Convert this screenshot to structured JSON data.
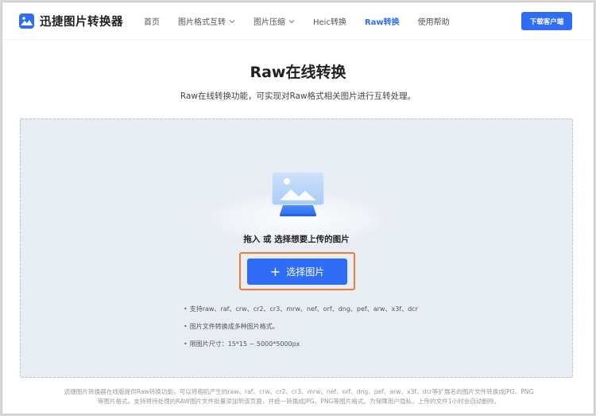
{
  "brand": {
    "name": "迅捷图片转换器"
  },
  "nav": {
    "items": [
      {
        "label": "首页",
        "has_dropdown": false,
        "active": false
      },
      {
        "label": "图片格式互转",
        "has_dropdown": true,
        "active": false
      },
      {
        "label": "图片压缩",
        "has_dropdown": true,
        "active": false
      },
      {
        "label": "Heic转换",
        "has_dropdown": false,
        "active": false
      },
      {
        "label": "Raw转换",
        "has_dropdown": false,
        "active": true
      },
      {
        "label": "使用帮助",
        "has_dropdown": false,
        "active": false
      }
    ]
  },
  "header": {
    "download_label": "下载客户端"
  },
  "main": {
    "title": "Raw在线转换",
    "subtitle": "Raw在线转换功能，可实现对Raw格式相关图片进行互转处理。"
  },
  "upload": {
    "drop_text": "拖入 或 选择想要上传的图片",
    "select_label": "选择图片",
    "bullets": [
      "支持raw、raf、crw、cr2、cr3、mrw、nef、orf、dng、pef、arw、x3f、dcr",
      "图片文件转换成多种图片格式。",
      "限图片尺寸：15*15 ~ 5000*5000px"
    ]
  },
  "footer": {
    "line1": "迅捷图片转换器在线版提供Raw转换功能，可以将相机产生的raw、raf、crw、cr2、cr3、mrw、nef、orf、dng、pef、arw、x3f、dcr等扩展名的图片文件转换成JPG、PNG",
    "line2": "等图片格式。支持将待处理的RAW图片文件批量添加到该页面，并统一转换成JPG、PNG等图片格式。为保障用户隐私，上传的文件1小时会自动删除。"
  },
  "colors": {
    "accent": "#2f6df6",
    "highlight": "#f07a3a",
    "zone_bg": "#e8ecf3"
  },
  "icons": {
    "logo": "image-icon",
    "dropdown": "chevron-down-icon",
    "upload": "upload-image-icon",
    "plus": "plus-icon"
  }
}
